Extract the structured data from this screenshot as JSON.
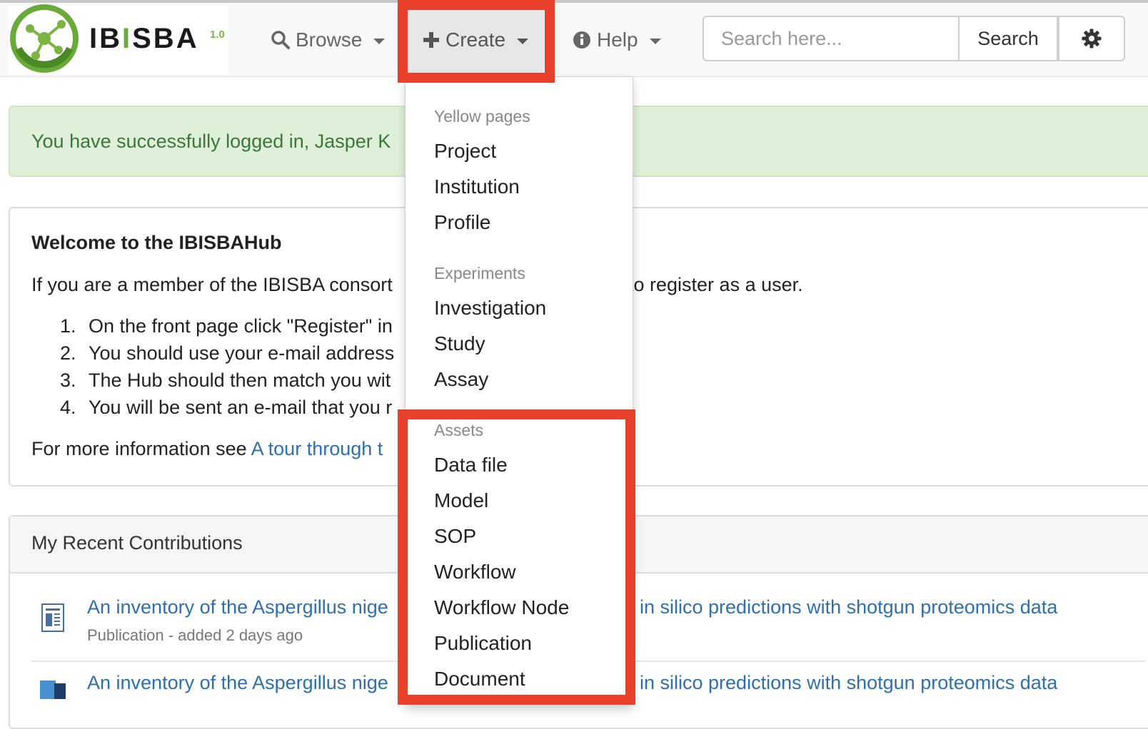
{
  "brand": {
    "name_left": "IB",
    "name_bar": "I",
    "name_right": "SBA",
    "version": "1.0",
    "accent_color": "#6aaa3a"
  },
  "navbar": {
    "browse_label": "Browse",
    "create_label": "Create",
    "help_label": "Help",
    "search": {
      "placeholder": "Search here...",
      "button_label": "Search"
    }
  },
  "alert": {
    "text": "You have successfully logged in, Jasper K"
  },
  "welcome": {
    "title": "Welcome to the IBISBAHub",
    "intro_left": "If you are a member of the IBISBA consort",
    "intro_right": "to register as a user.",
    "steps": [
      {
        "num": "1.",
        "text": "On the front page click \"Register\" in"
      },
      {
        "num": "2.",
        "text": "You should use your e-mail address"
      },
      {
        "num": "3.",
        "text": "The Hub should then match you wit"
      },
      {
        "num": "4.",
        "text": "You will be sent an e-mail that you r"
      }
    ],
    "more_info_prefix": "For more information see ",
    "more_info_link": "A tour through t"
  },
  "contributions": {
    "title": "My Recent Contributions",
    "items": [
      {
        "title_left": "An inventory of the Aspergillus nige",
        "title_right": "in silico predictions with shotgun proteomics data",
        "meta": "Publication - added 2 days ago"
      },
      {
        "title_left": "An inventory of the Aspergillus nige",
        "title_right": "in silico predictions with shotgun proteomics data"
      }
    ]
  },
  "create_menu": {
    "sections": [
      {
        "header": "Yellow pages",
        "items": [
          "Project",
          "Institution",
          "Profile"
        ]
      },
      {
        "header": "Experiments",
        "items": [
          "Investigation",
          "Study",
          "Assay"
        ]
      },
      {
        "header": "Assets",
        "items": [
          "Data file",
          "Model",
          "SOP",
          "Workflow",
          "Workflow Node",
          "Publication",
          "Document"
        ]
      }
    ]
  },
  "highlight_color": "#e8402a"
}
